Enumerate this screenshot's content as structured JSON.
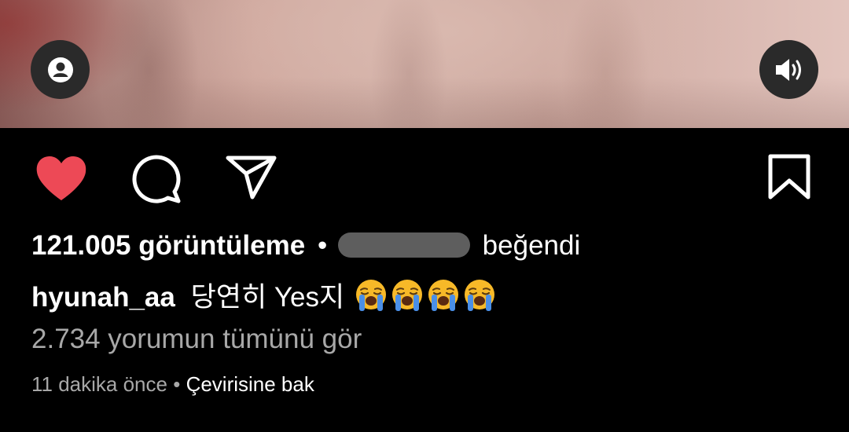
{
  "post": {
    "views_text": "121.005 görüntüleme",
    "separator": "•",
    "liked_by_suffix": "beğendi",
    "caption_username": "hyunah_aa",
    "caption_text": "당연히 Yes지",
    "caption_emojis": [
      "loudly-crying-face",
      "loudly-crying-face",
      "loudly-crying-face",
      "loudly-crying-face"
    ],
    "view_comments": "2.734 yorumun tümünü gör",
    "time_ago": "11 dakika önce",
    "see_translation": "Çevirisine bak"
  },
  "icons": {
    "like": "heart-icon",
    "comment": "comment-icon",
    "share": "paper-plane-icon",
    "save": "bookmark-icon",
    "profile": "user-icon",
    "sound": "volume-icon"
  },
  "colors": {
    "background": "#000000",
    "like_red": "#ed4956",
    "secondary_text": "#a8a8a8",
    "overlay_button": "#2a2a2a"
  }
}
